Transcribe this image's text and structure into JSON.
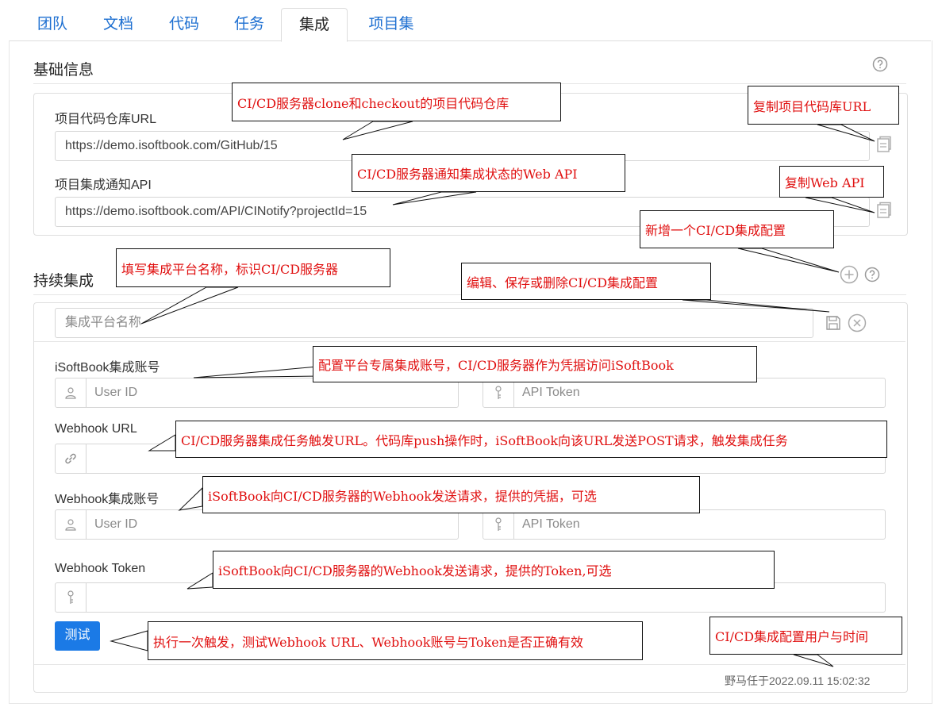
{
  "tabs": [
    "团队",
    "文档",
    "代码",
    "任务",
    "集成",
    "项目集"
  ],
  "active_tab": "集成",
  "basic": {
    "title": "基础信息",
    "repo_label": "项目代码仓库URL",
    "repo_url": "https://demo.isoftbook.com/GitHub/15",
    "notify_label": "项目集成通知API",
    "notify_url": "https://demo.isoftbook.com/API/CINotify?projectId=15"
  },
  "ci": {
    "title": "持续集成",
    "platform_placeholder": "集成平台名称",
    "account_label": "iSoftBook集成账号",
    "user_id_placeholder": "User ID",
    "api_token_placeholder": "API Token",
    "webhook_url_label": "Webhook URL",
    "webhook_account_label": "Webhook集成账号",
    "webhook_token_label": "Webhook Token",
    "test_button": "测试",
    "meta": "野马任于2022.09.11 15:02:32"
  },
  "annotations": {
    "repo": "CI/CD服务器clone和checkout的项目代码仓库",
    "copy_repo": "复制项目代码库URL",
    "notify": "CI/CD服务器通知集成状态的Web API",
    "copy_api": "复制Web API",
    "add_config": "新增一个CI/CD集成配置",
    "platform_name": "填写集成平台名称，标识CI/CD服务器",
    "edit_config": "编辑、保存或删除CI/CD集成配置",
    "account": "配置平台专属集成账号，CI/CD服务器作为凭据访问iSoftBook",
    "webhook_url": "CI/CD服务器集成任务触发URL。代码库push操作时，iSoftBook向该URL发送POST请求，触发集成任务",
    "webhook_account": "iSoftBook向CI/CD服务器的Webhook发送请求，提供的凭据，可选",
    "webhook_token": "iSoftBook向CI/CD服务器的Webhook发送请求，提供的Token,可选",
    "test": "执行一次触发，测试Webhook URL、Webhook账号与Token是否正确有效",
    "meta": "CI/CD集成配置用户与时间"
  }
}
